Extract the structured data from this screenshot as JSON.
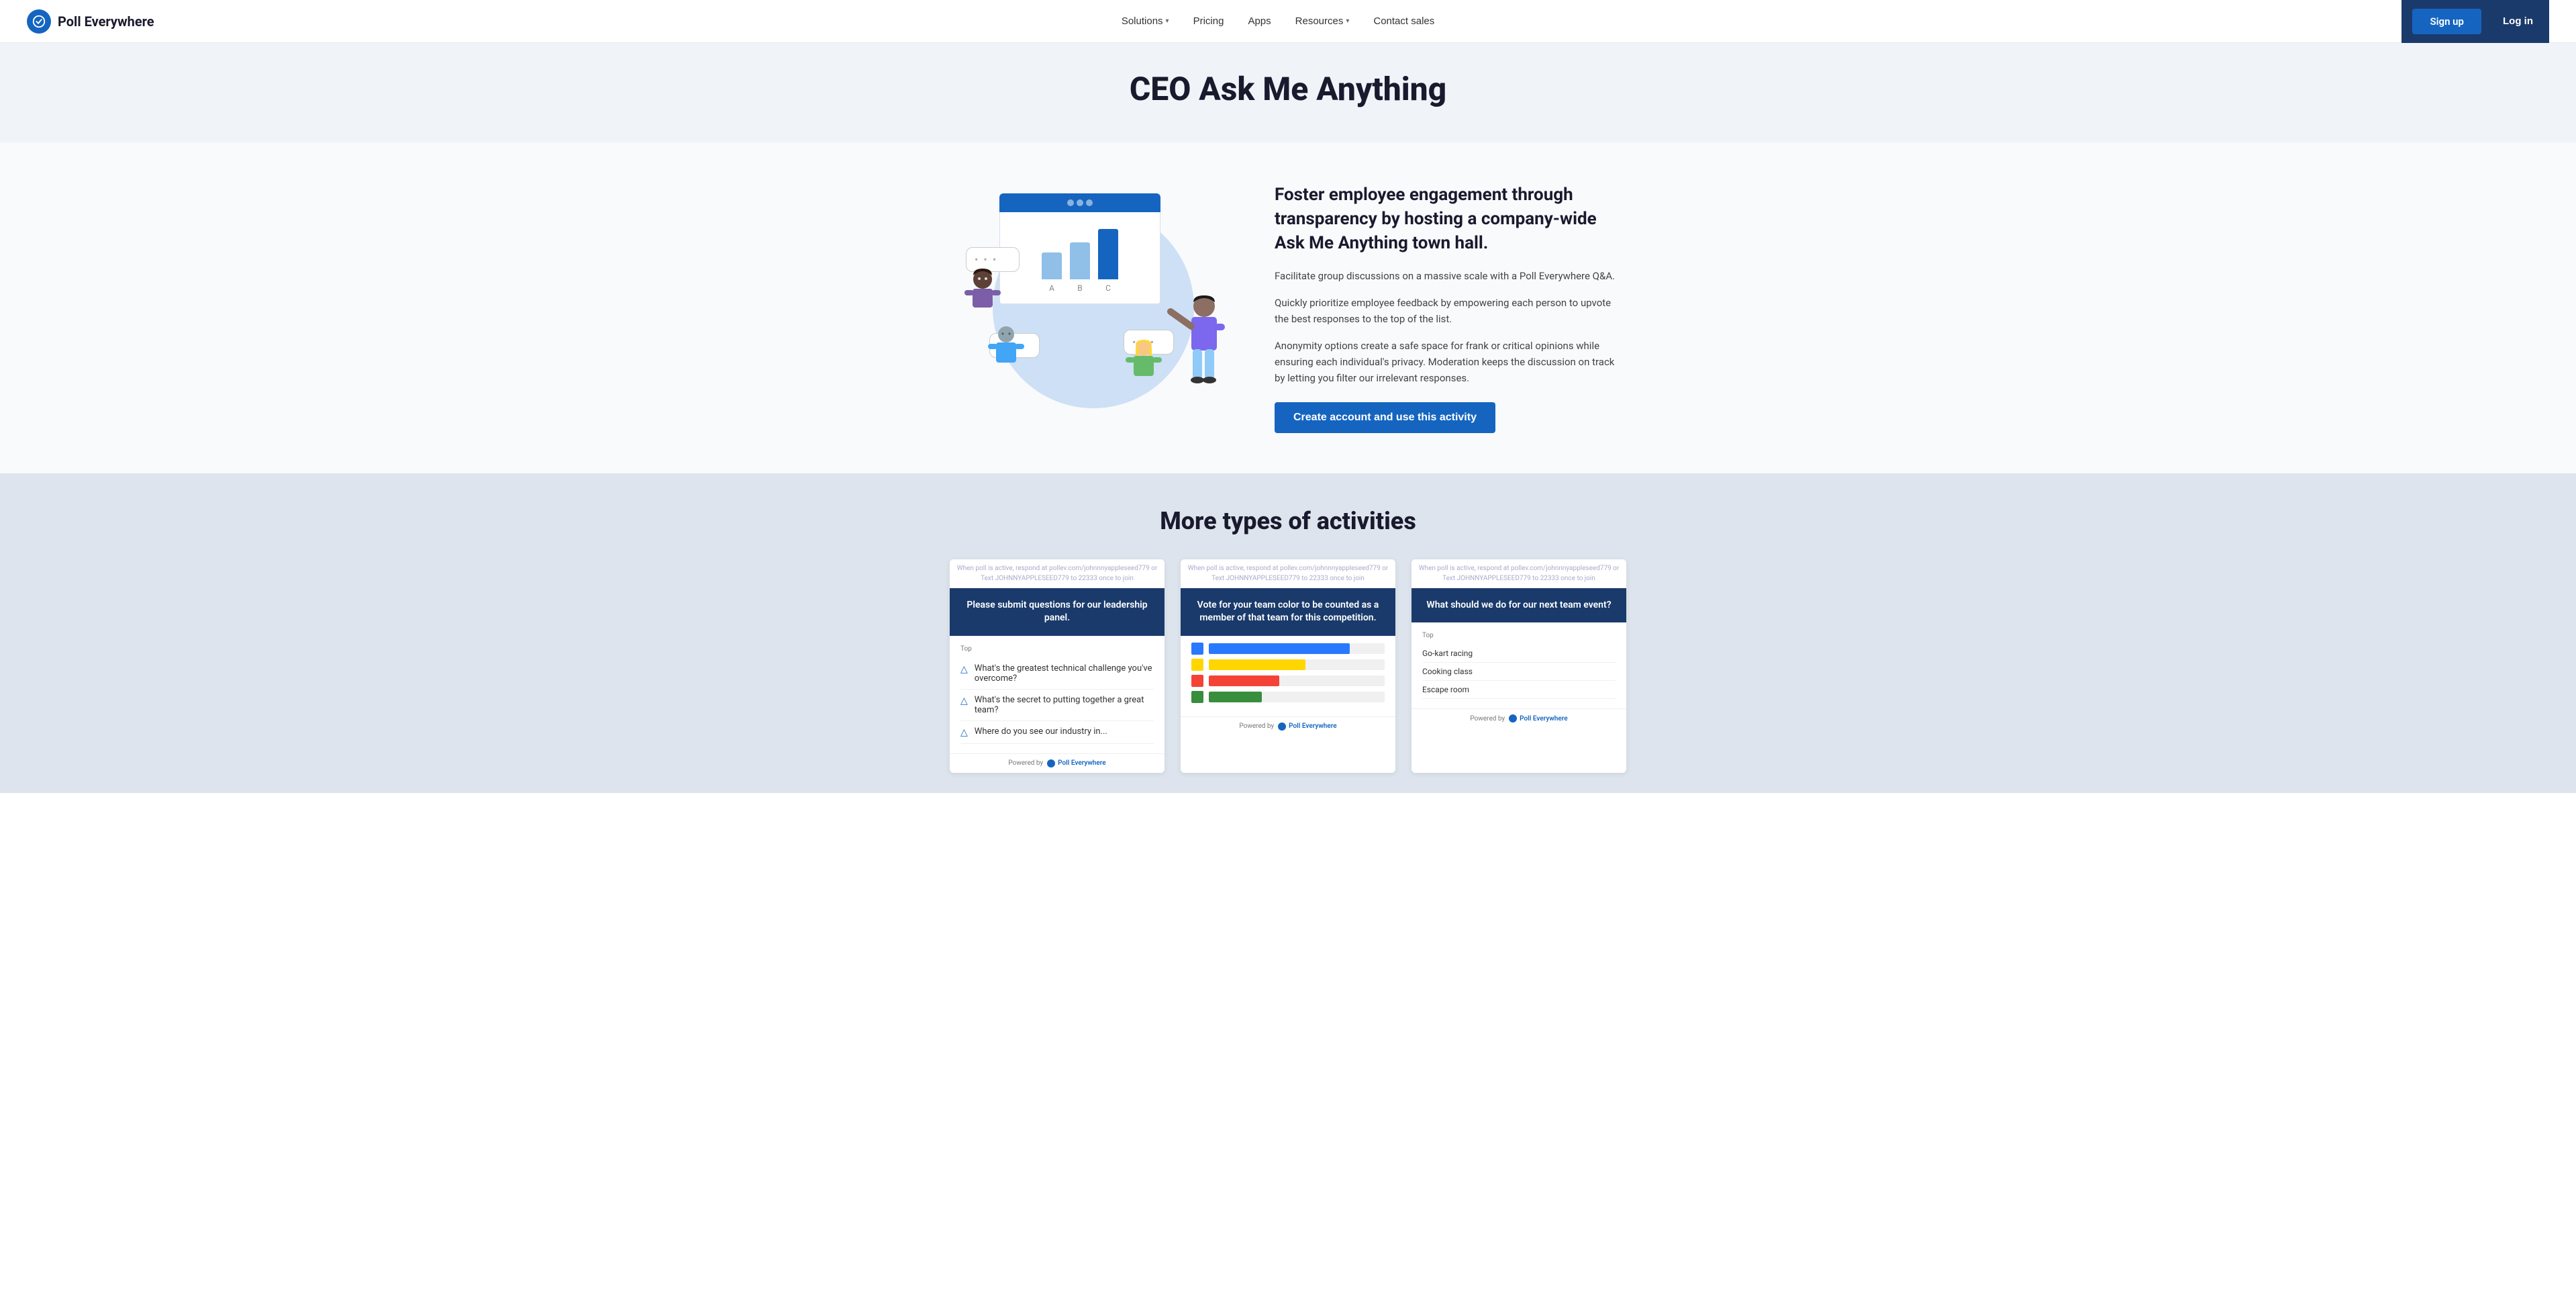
{
  "nav": {
    "logo_text": "Poll Everywhere",
    "links": [
      {
        "label": "Solutions",
        "has_dropdown": true
      },
      {
        "label": "Pricing",
        "has_dropdown": false
      },
      {
        "label": "Apps",
        "has_dropdown": false
      },
      {
        "label": "Resources",
        "has_dropdown": true
      },
      {
        "label": "Contact sales",
        "has_dropdown": false
      }
    ],
    "signup_label": "Sign up",
    "login_label": "Log in"
  },
  "hero": {
    "title": "CEO Ask Me Anything"
  },
  "content": {
    "heading": "Foster employee engagement through transparency by hosting a company-wide Ask Me Anything town hall.",
    "para1": "Facilitate group discussions on a massive scale with a Poll Everywhere Q&A.",
    "para2": "Quickly prioritize employee feedback by empowering each person to upvote the best responses to the top of the list.",
    "para3": "Anonymity options create a safe space for frank or critical opinions while ensuring each individual's privacy. Moderation keeps the discussion on track by letting you filter our irrelevant responses.",
    "cta_label": "Create account and use this activity"
  },
  "more": {
    "title": "More types of activities",
    "cards": [
      {
        "subheader": "When poll is active, respond at pollev.com/johnnnyappleseed779\nor Text JOHNNYAPPLESEED779 to 22333 once to join",
        "header": "Please submit questions for our leadership panel.",
        "top_label": "Top",
        "items": [
          "What's the greatest technical challenge you've overcome?",
          "What's the secret to putting together a great team?",
          "Where do you see our industry in..."
        ],
        "footer_powered": "Powered by",
        "footer_brand": "Poll Everywhere"
      },
      {
        "subheader": "When poll is active, respond at pollev.com/johnnnyappleseed779\nor Text JOHNNYAPPLESEED779 to 22333 once to join",
        "header": "Vote for your team color to be counted as a member of that team for this competition.",
        "bars": [
          {
            "color": "#2979ff",
            "width": "80%"
          },
          {
            "color": "#ffd600",
            "width": "55%"
          },
          {
            "color": "#f44336",
            "width": "40%"
          },
          {
            "color": "#388e3c",
            "width": "30%"
          }
        ],
        "footer_powered": "Powered by",
        "footer_brand": "Poll Everywhere"
      },
      {
        "subheader": "When poll is active, respond at pollev.com/johnnnyappleseed779\nor Text JOHNNYAPPLESEED779 to 22333 once to join",
        "header": "What should we do for our next team event?",
        "top_label": "Top",
        "responses": [
          "Go-kart racing",
          "Cooking class",
          "Escape room"
        ],
        "footer_powered": "Powered by",
        "footer_brand": "Poll Everywhere"
      }
    ]
  },
  "illustration": {
    "bars": [
      {
        "height": 40,
        "tall": false
      },
      {
        "height": 55,
        "tall": false
      },
      {
        "height": 75,
        "tall": true
      }
    ],
    "bar_labels": [
      "A",
      "B",
      "C"
    ]
  }
}
